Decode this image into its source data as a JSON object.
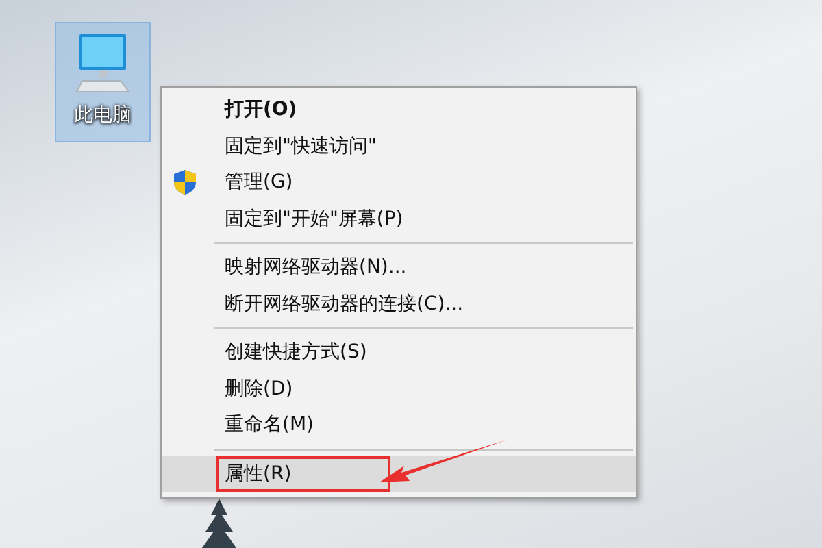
{
  "desktop_icon": {
    "label": "此电脑",
    "selected": true
  },
  "context_menu": {
    "items": [
      {
        "kind": "item",
        "label": "打开(O)",
        "bold": true,
        "selected": false,
        "highlighted": false
      },
      {
        "kind": "item",
        "label": "固定到\"快速访问\"",
        "bold": false,
        "selected": false,
        "highlighted": false
      },
      {
        "kind": "shield_item",
        "label": "管理(G)",
        "bold": false,
        "selected": false,
        "highlighted": false
      },
      {
        "kind": "item",
        "label": "固定到\"开始\"屏幕(P)",
        "bold": false,
        "selected": false,
        "highlighted": false
      },
      {
        "kind": "separator"
      },
      {
        "kind": "item",
        "label": "映射网络驱动器(N)...",
        "bold": false,
        "selected": false,
        "highlighted": false
      },
      {
        "kind": "item",
        "label": "断开网络驱动器的连接(C)...",
        "bold": false,
        "selected": false,
        "highlighted": false
      },
      {
        "kind": "separator"
      },
      {
        "kind": "item",
        "label": "创建快捷方式(S)",
        "bold": false,
        "selected": false,
        "highlighted": false
      },
      {
        "kind": "item",
        "label": "删除(D)",
        "bold": false,
        "selected": false,
        "highlighted": false
      },
      {
        "kind": "item",
        "label": "重命名(M)",
        "bold": false,
        "selected": false,
        "highlighted": false
      },
      {
        "kind": "separator"
      },
      {
        "kind": "item",
        "label": "属性(R)",
        "bold": false,
        "selected": true,
        "highlighted": true
      }
    ]
  }
}
